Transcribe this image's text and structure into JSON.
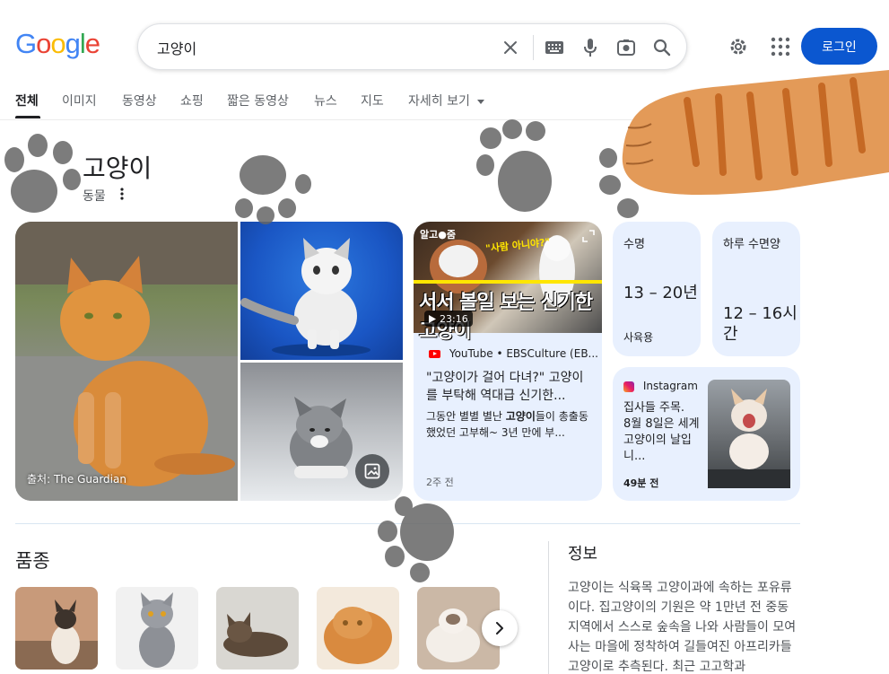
{
  "logo": {
    "letters": [
      {
        "ch": "G",
        "color": "#4285f4"
      },
      {
        "ch": "o",
        "color": "#ea4335"
      },
      {
        "ch": "o",
        "color": "#fbbc05"
      },
      {
        "ch": "g",
        "color": "#4285f4"
      },
      {
        "ch": "l",
        "color": "#34a853"
      },
      {
        "ch": "e",
        "color": "#ea4335"
      }
    ]
  },
  "search": {
    "query": "고양이"
  },
  "header": {
    "login_label": "로그인"
  },
  "tabs": [
    {
      "label": "전체",
      "active": true
    },
    {
      "label": "이미지"
    },
    {
      "label": "동영상"
    },
    {
      "label": "쇼핑"
    },
    {
      "label": "짧은 동영상"
    },
    {
      "label": "뉴스"
    },
    {
      "label": "지도"
    },
    {
      "label": "자세히 보기"
    }
  ],
  "knowledge_panel": {
    "title": "고양이",
    "subtitle": "동물"
  },
  "images": {
    "main_caption": "출처: The Guardian"
  },
  "video_card": {
    "thumb_brand": "알고●줌",
    "thumb_quote": "\"사람 아니야?\"",
    "thumb_headline": "서서 볼일 보는 신기한 고양이",
    "duration": "23:16",
    "source": "YouTube • EBSCulture (EB...",
    "title": "\"고양이가 걸어 다녀?\" 고양이를 부탁해 역대급 신기한...",
    "desc_before": "그동안 별별 별난 ",
    "desc_bold": "고양이",
    "desc_after": "들이 총출동했었던 고부해~ 3년 만에 부...",
    "time": "2주 전"
  },
  "stats": [
    {
      "label": "수명",
      "value": "13 – 20년",
      "unit": "사육용"
    },
    {
      "label": "하루 수면양",
      "value": "12 – 16시간",
      "unit": ""
    }
  ],
  "instagram_card": {
    "source": "Instagram",
    "text": "집사들 주목. ᅟ 8월 8일은 세계 고양이의 날입니...",
    "time": "49분 전"
  },
  "breeds": {
    "title": "품종",
    "count": 5
  },
  "info": {
    "title": "정보",
    "body": "고양이는 식육목 고양이과에 속하는 포유류이다. 집고양이의 기원은 약 1만년 전 중동 지역에서 스스로 숲속을 나와 사람들이 모여사는 마을에 정착하여 길들여진 아프리카들고양이로 추측된다. 최근 고고학과"
  },
  "colors": {
    "accent": "#0b57d0",
    "card_bg": "#e8f0fe",
    "tab_active": "#202124"
  }
}
